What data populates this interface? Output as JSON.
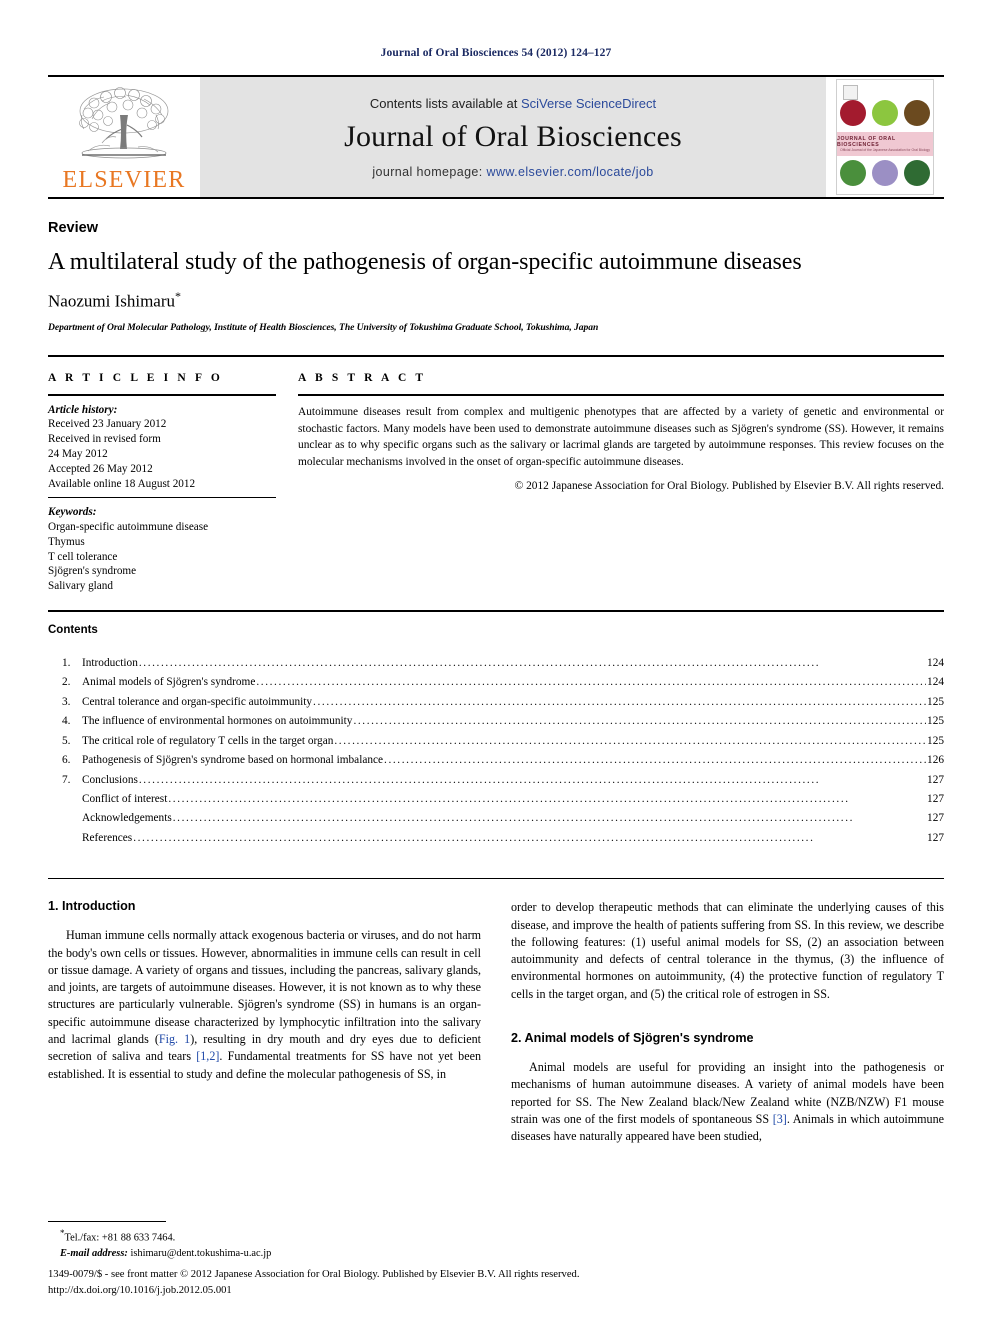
{
  "running_head": "Journal of Oral Biosciences 54 (2012) 124–127",
  "masthead": {
    "contents_prefix": "Contents lists available at ",
    "contents_link": "SciVerse ScienceDirect",
    "journal_title": "Journal of Oral Biosciences",
    "homepage_prefix": "journal homepage: ",
    "homepage_url": "www.elsevier.com/locate/job",
    "publisher_wordmark": "ELSEVIER",
    "cover_title": "JOURNAL OF ORAL BIOSCIENCES",
    "cover_subtitle": "Official Journal of the Japanese Association for Oral Biology",
    "cover_colors": [
      "#a31b2e",
      "#8cc63f",
      "#6b4a1f",
      "#4a8f3c",
      "#9b8fc4",
      "#2f6b33"
    ],
    "link_color": "#2b4a9b",
    "elsevier_orange": "#E87722"
  },
  "article": {
    "doctype": "Review",
    "title": "A multilateral study of the pathogenesis of organ-specific autoimmune diseases",
    "author": "Naozumi Ishimaru",
    "author_marker": "*",
    "affiliation": "Department of Oral Molecular Pathology, Institute of Health Biosciences, The University of Tokushima Graduate School, Tokushima, Japan"
  },
  "info": {
    "heading": "A R T I C L E  I N F O",
    "history_label": "Article history:",
    "history": [
      "Received 23 January 2012",
      "Received in revised form",
      "24 May 2012",
      "Accepted 26 May 2012",
      "Available online 18 August 2012"
    ],
    "keywords_label": "Keywords:",
    "keywords": [
      "Organ-specific autoimmune disease",
      "Thymus",
      "T cell tolerance",
      "Sjögren's syndrome",
      "Salivary gland"
    ]
  },
  "abstract": {
    "heading": "A B S T R A C T",
    "text": "Autoimmune diseases result from complex and multigenic phenotypes that are affected by a variety of genetic and environmental or stochastic factors. Many models have been used to demonstrate autoimmune diseases such as Sjögren's syndrome (SS). However, it remains unclear as to why specific organs such as the salivary or lacrimal glands are targeted by autoimmune responses. This review focuses on the molecular mechanisms involved in the onset of organ-specific autoimmune diseases.",
    "copyright": "© 2012 Japanese Association for Oral Biology. Published by Elsevier B.V. All rights reserved."
  },
  "contents": {
    "heading": "Contents",
    "entries": [
      {
        "num": "1.",
        "label": "Introduction",
        "page": "124",
        "sub": false
      },
      {
        "num": "2.",
        "label": "Animal models of Sjögren's syndrome",
        "page": "124",
        "sub": false
      },
      {
        "num": "3.",
        "label": "Central tolerance and organ-specific autoimmunity",
        "page": "125",
        "sub": false
      },
      {
        "num": "4.",
        "label": "The influence of environmental hormones on autoimmunity",
        "page": "125",
        "sub": false
      },
      {
        "num": "5.",
        "label": "The critical role of regulatory T cells in the target organ",
        "page": "125",
        "sub": false
      },
      {
        "num": "6.",
        "label": "Pathogenesis of Sjögren's syndrome based on hormonal imbalance",
        "page": "126",
        "sub": false
      },
      {
        "num": "7.",
        "label": "Conclusions",
        "page": "127",
        "sub": false
      },
      {
        "num": "",
        "label": "Conflict of interest",
        "page": "127",
        "sub": true
      },
      {
        "num": "",
        "label": "Acknowledgements",
        "page": "127",
        "sub": true
      },
      {
        "num": "",
        "label": "References",
        "page": "127",
        "sub": true
      }
    ]
  },
  "body": {
    "section1_heading": "1.  Introduction",
    "left_para1": "Human immune cells normally attack exogenous bacteria or viruses, and do not harm the body's own cells or tissues. However, abnormalities in immune cells can result in cell or tissue damage. A variety of organs and tissues, including the pancreas, salivary glands, and joints, are targets of autoimmune diseases. However, it is not known as to why these structures are particularly vulnerable. Sjögren's syndrome (SS) in humans is an organ-specific autoimmune disease characterized by lymphocytic infiltration into the salivary and lacrimal glands ",
    "left_link1": "Fig. 1",
    "left_para1b": "), resulting in dry mouth and dry eyes due to deficient secretion of saliva and tears ",
    "left_link2": "[1,2]",
    "left_para1c": ". Fundamental treatments for SS have not yet been established. It is essential to study and define the molecular pathogenesis of SS, in",
    "right_para1": "order to develop therapeutic methods that can eliminate the underlying causes of this disease, and improve the health of patients suffering from SS. In this review, we describe the following features: (1) useful animal models for SS, (2) an association between autoimmunity and defects of central tolerance in the thymus, (3) the influence of environmental hormones on autoimmunity, (4) the protective function of regulatory T cells in the target organ, and (5) the critical role of estrogen in SS.",
    "section2_heading": "2.  Animal models of Sjögren's syndrome",
    "right_para2": "Animal models are useful for providing an insight into the pathogenesis or mechanisms of human autoimmune diseases. A variety of animal models have been reported for SS. The New Zealand black/New Zealand white (NZB/NZW) F1 mouse strain was one of the first models of spontaneous SS ",
    "right_link1": "[3]",
    "right_para2b": ". Animals in which autoimmune diseases have naturally appeared have been studied,"
  },
  "footnote": {
    "tel": "Tel./fax: +81 88 633 7464.",
    "email_label": "E-mail address:",
    "email": "ishimaru@dent.tokushima-u.ac.jp"
  },
  "page_footer": {
    "line1": "1349-0079/$ - see front matter © 2012 Japanese Association for Oral Biology. Published by Elsevier B.V. All rights reserved.",
    "line2": "http://dx.doi.org/10.1016/j.job.2012.05.001"
  }
}
